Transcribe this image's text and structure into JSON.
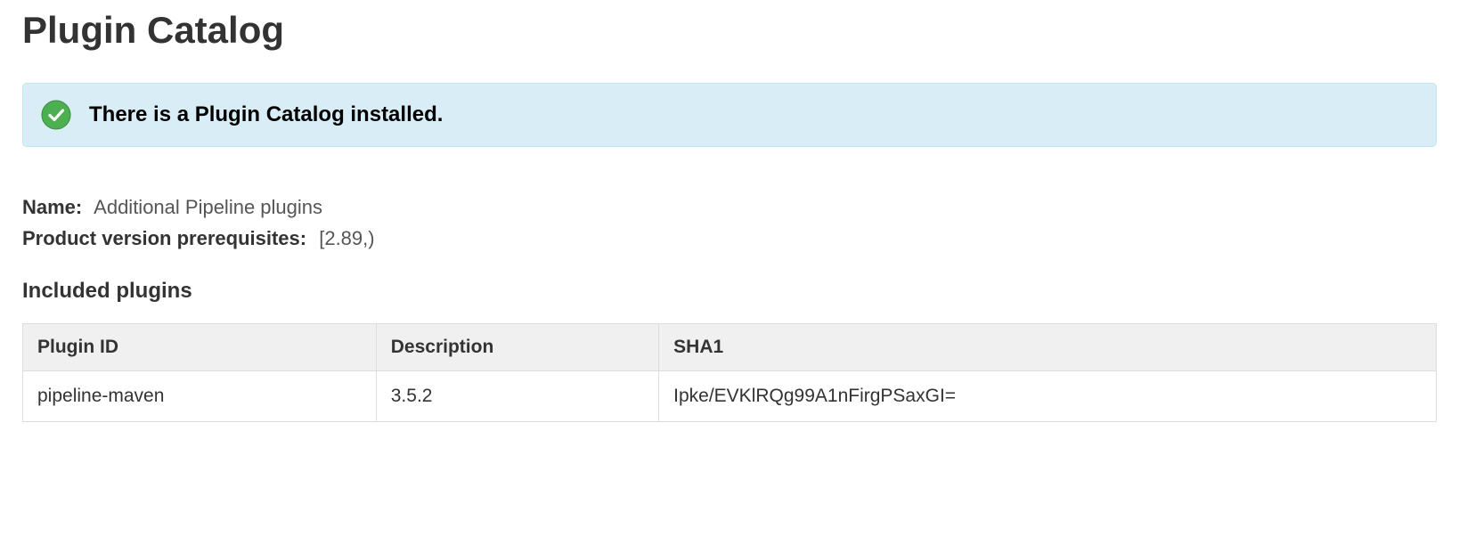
{
  "page_title": "Plugin Catalog",
  "alert": {
    "message": "There is a Plugin Catalog installed."
  },
  "details": {
    "name_label": "Name:",
    "name_value": "Additional Pipeline plugins",
    "prereq_label": "Product version prerequisites:",
    "prereq_value": "[2.89,)"
  },
  "section_title": "Included plugins",
  "table": {
    "headers": {
      "plugin_id": "Plugin ID",
      "description": "Description",
      "sha1": "SHA1"
    },
    "rows": [
      {
        "plugin_id": "pipeline-maven",
        "description": "3.5.2",
        "sha1": "Ipke/EVKlRQg99A1nFirgPSaxGI="
      }
    ]
  }
}
